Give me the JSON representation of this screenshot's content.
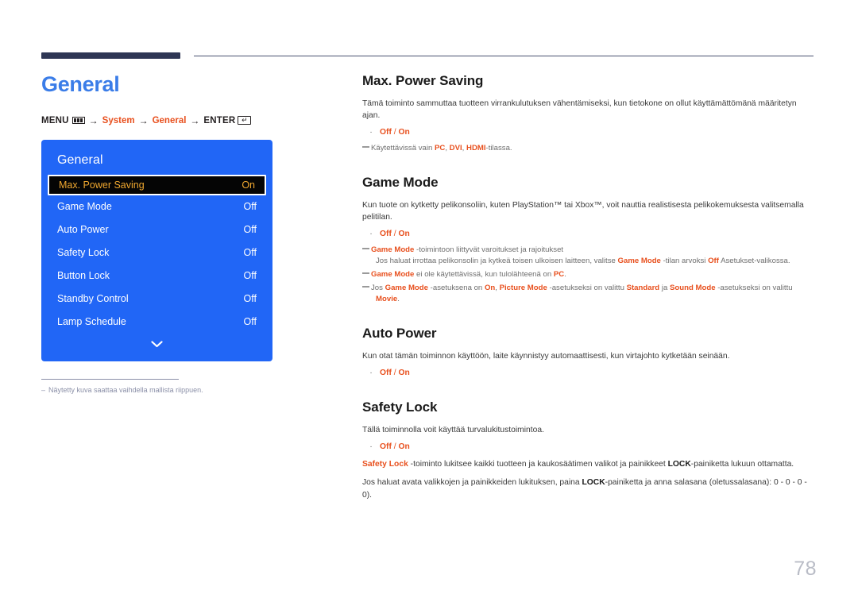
{
  "page": {
    "title": "General",
    "number": "78",
    "accent_color": "#e8501e",
    "title_color": "#3b7de8",
    "rule_color": "#2e3654"
  },
  "breadcrumb": {
    "menu_label": "MENU",
    "menu_icon": "menu-bars-icon",
    "arrow": "→",
    "items": [
      {
        "label": "System",
        "accent": true
      },
      {
        "label": "General",
        "accent": true
      }
    ],
    "enter_label": "ENTER",
    "enter_icon": "enter-key-icon",
    "enter_glyph": "↵"
  },
  "osd": {
    "title": "General",
    "panel_color": "#2166f6",
    "selected_text_color": "#f0a830",
    "chevron_icon": "chevron-down-icon",
    "rows": [
      {
        "label": "Max. Power Saving",
        "value": "On",
        "selected": true
      },
      {
        "label": "Game Mode",
        "value": "Off",
        "selected": false
      },
      {
        "label": "Auto Power",
        "value": "Off",
        "selected": false
      },
      {
        "label": "Safety Lock",
        "value": "Off",
        "selected": false
      },
      {
        "label": "Button Lock",
        "value": "Off",
        "selected": false
      },
      {
        "label": "Standby Control",
        "value": "Off",
        "selected": false
      },
      {
        "label": "Lamp Schedule",
        "value": "Off",
        "selected": false
      }
    ]
  },
  "left_note": {
    "dash": "–",
    "text": "Näytetty kuva saattaa vaihdella mallista riippuen."
  },
  "sections": {
    "max_power_saving": {
      "heading": "Max. Power Saving",
      "body": "Tämä toiminto sammuttaa tuotteen virrankulutuksen vähentämiseksi, kun tietokone on ollut käyttämättömänä määritetyn ajan.",
      "option_off": "Off",
      "option_sep": " / ",
      "option_on": "On",
      "note_prefix": "Käytettävissä vain ",
      "note_pc": "PC",
      "note_sep1": ", ",
      "note_dvi": "DVI",
      "note_sep2": ", ",
      "note_hdmi": "HDMI",
      "note_suffix": "-tilassa."
    },
    "game_mode": {
      "heading": "Game Mode",
      "body": "Kun tuote on kytketty pelikonsoliin, kuten PlayStation™ tai Xbox™, voit nauttia realistisesta pelikokemuksesta valitsemalla pelitilan.",
      "option_off": "Off",
      "option_sep": " / ",
      "option_on": "On",
      "note1_title": "Game Mode",
      "note1_rest": " -toimintoon liittyvät varoitukset ja rajoitukset",
      "note1_sub_a": "Jos haluat irrottaa pelikonsolin ja kytkeä toisen ulkoisen laitteen, valitse ",
      "note1_sub_b": "Game Mode",
      "note1_sub_c": " -tilan arvoksi ",
      "note1_sub_d": "Off",
      "note1_sub_e": " Asetukset-valikossa.",
      "note2_a": "Game Mode",
      "note2_b": " ei ole käytettävissä, kun tulolähteenä on ",
      "note2_c": "PC",
      "note2_d": ".",
      "note3_a": "Jos ",
      "note3_b": "Game Mode",
      "note3_c": " -asetuksena on ",
      "note3_d": "On",
      "note3_e": ", ",
      "note3_f": "Picture Mode",
      "note3_g": " -asetukseksi on valittu ",
      "note3_h": "Standard",
      "note3_i": " ja ",
      "note3_j": "Sound Mode",
      "note3_k": " -asetukseksi on valittu ",
      "note3_l": "Movie",
      "note3_m": "."
    },
    "auto_power": {
      "heading": "Auto Power",
      "body": "Kun otat tämän toiminnon käyttöön, laite käynnistyy automaattisesti, kun virtajohto kytketään seinään.",
      "option_off": "Off",
      "option_sep": " / ",
      "option_on": "On"
    },
    "safety_lock": {
      "heading": "Safety Lock",
      "body": "Tällä toiminnolla voit käyttää turvalukitustoimintoa.",
      "option_off": "Off",
      "option_sep": " / ",
      "option_on": "On",
      "para1_a": "Safety Lock",
      "para1_b": " -toiminto lukitsee kaikki tuotteen ja kaukosäätimen valikot ja painikkeet ",
      "para1_c": "LOCK",
      "para1_d": "-painiketta lukuun ottamatta.",
      "para2_a": "Jos haluat avata valikkojen ja painikkeiden lukituksen, paina ",
      "para2_b": "LOCK",
      "para2_c": "-painiketta ja anna salasana (oletussalasana): 0 - 0 - 0 - 0)."
    }
  }
}
